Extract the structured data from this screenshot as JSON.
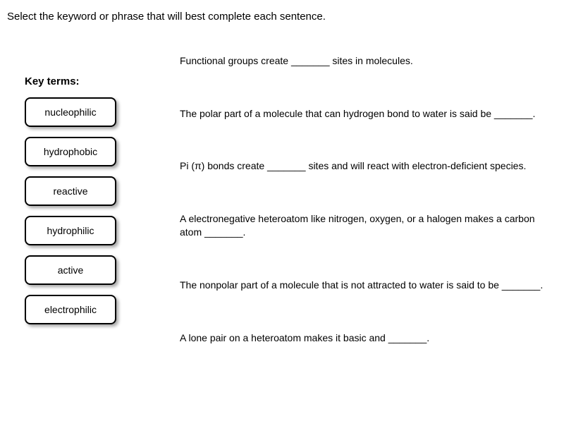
{
  "instruction": "Select the keyword or phrase that will best complete each sentence.",
  "keyTermsHeading": "Key terms:",
  "terms": [
    "nucleophilic",
    "hydrophobic",
    "reactive",
    "hydrophilic",
    "active",
    "electrophilic"
  ],
  "sentences": [
    "Functional groups create _______ sites in molecules.",
    "The polar part of a molecule that can hydrogen bond to water is said be _______.",
    "Pi (π) bonds create _______ sites and will react with electron-deficient species.",
    "A electronegative heteroatom like nitrogen, oxygen, or a halogen makes a carbon atom _______.",
    "The nonpolar part of a molecule that is not attracted to water is said to be _______.",
    "A lone pair on a heteroatom makes it basic and _______."
  ]
}
